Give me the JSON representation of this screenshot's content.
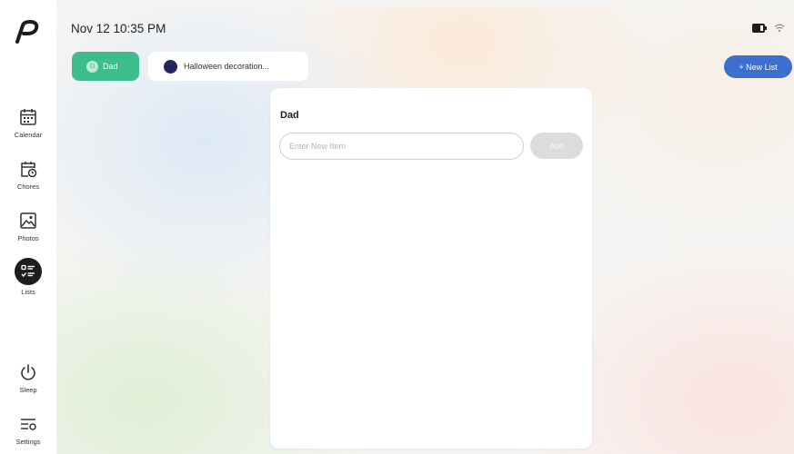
{
  "app": {
    "logo": "P"
  },
  "status_bar": {
    "datetime": "Nov 12 10:35 PM",
    "icons": [
      "battery-icon",
      "wifi-icon"
    ]
  },
  "sidebar": {
    "items": [
      {
        "label": "Calendar",
        "icon": "calendar-icon",
        "active": false
      },
      {
        "label": "Chores",
        "icon": "chores-icon",
        "active": false
      },
      {
        "label": "Photos",
        "icon": "photos-icon",
        "active": false
      },
      {
        "label": "Lists",
        "icon": "lists-icon",
        "active": true
      },
      {
        "label": "Sleep",
        "icon": "power-icon",
        "active": false
      },
      {
        "label": "Settings",
        "icon": "settings-icon",
        "active": false
      }
    ]
  },
  "list_tabs": [
    {
      "label": "Dad",
      "avatar_letter": "D",
      "color": "#3dbc8c",
      "selected": true
    },
    {
      "label": "Halloween decoration...",
      "color": "#23265c",
      "selected": false
    }
  ],
  "new_list_button": "+ New List",
  "panel": {
    "title": "Dad",
    "input": {
      "placeholder": "Enter New Item",
      "value": ""
    },
    "add_button": "Add"
  },
  "colors": {
    "accent_green": "#3dbc8c",
    "accent_blue": "#3d6fd1",
    "active_nav": "#1d1d1f"
  }
}
